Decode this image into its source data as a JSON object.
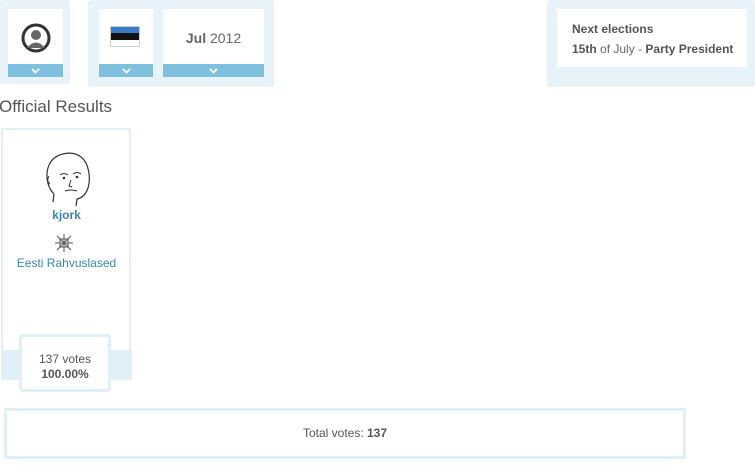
{
  "header": {
    "avatar_icon": "user-avatar-icon",
    "country_flag": "estonia-flag-icon",
    "date": {
      "month": "Jul",
      "year": "2012"
    },
    "elections": {
      "label": "Next elections",
      "day": "15th",
      "of_text": "of July",
      "separator": " - ",
      "type": "Party President"
    }
  },
  "results": {
    "title": "Official Results",
    "candidate": {
      "name": "kjork",
      "party": "Eesti Rahvuslased",
      "votes_text": "137 votes",
      "percent": "100.00%"
    },
    "total_label": "Total votes: ",
    "total_value": "137"
  },
  "colors": {
    "panel": "#e7f2f9",
    "chevron_bar": "#7fc0de",
    "link": "#3a88b0"
  }
}
